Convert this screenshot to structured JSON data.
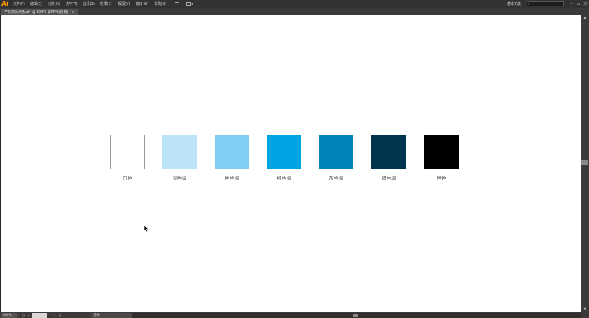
{
  "app": {
    "logo": "Ai"
  },
  "menu": {
    "items": [
      "文件(F)",
      "编辑(E)",
      "对象(O)",
      "文字(T)",
      "选择(S)",
      "效果(C)",
      "视图(V)",
      "窗口(W)",
      "帮助(H)"
    ],
    "icons": [
      "bridge-icon",
      "arrange-documents-icon"
    ]
  },
  "workspace": {
    "label": "基本功能"
  },
  "search": {
    "placeholder": ""
  },
  "tab": {
    "title": "学员常见调色.ai* @ 300% (CMYK/预览)",
    "close": "×"
  },
  "swatches": [
    {
      "label": "白色",
      "color": "#ffffff",
      "border": "#999999"
    },
    {
      "label": "淡色调",
      "color": "#bce4f7",
      "border": ""
    },
    {
      "label": "明色调",
      "color": "#7ecff3",
      "border": ""
    },
    {
      "label": "纯色调",
      "color": "#00a6e4",
      "border": ""
    },
    {
      "label": "灰色调",
      "color": "#0085b8",
      "border": ""
    },
    {
      "label": "暗色调",
      "color": "#02344f",
      "border": ""
    },
    {
      "label": "黑色",
      "color": "#000000",
      "border": ""
    }
  ],
  "status": {
    "zoom": "300%",
    "text": "选择"
  }
}
